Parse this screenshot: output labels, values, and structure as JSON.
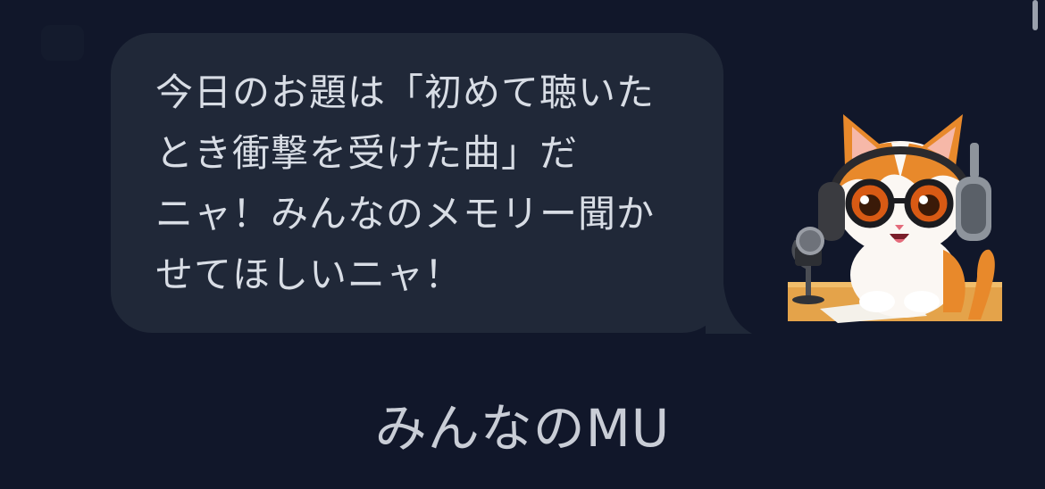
{
  "message": {
    "text": "今日のお題は「初めて聴いた\nとき衝撃を受けた曲」だ\nニャ！みんなのメモリー聞か\nせてほしいニャ！"
  },
  "sticker": {
    "icon": "cat-dj-headphones-icon"
  },
  "footer": {
    "title": "みんなのMU"
  },
  "colors": {
    "background": "#11172a",
    "bubble": "#202838",
    "text": "#d8dde5",
    "footer_text": "#c9cdd6"
  }
}
